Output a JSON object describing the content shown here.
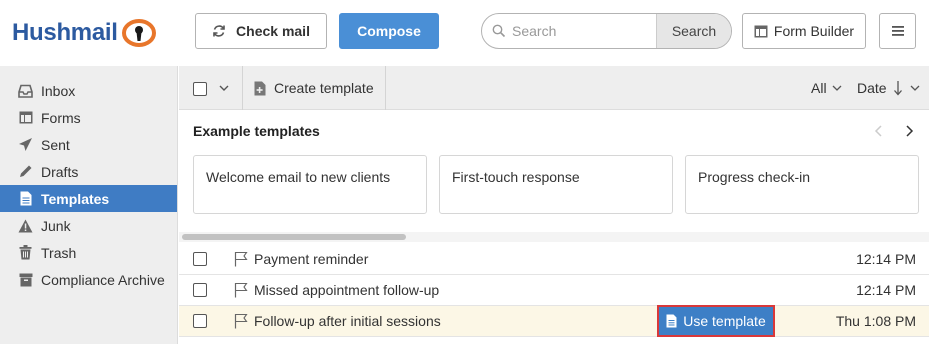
{
  "header": {
    "logo_text": "Hushmail",
    "check_mail_label": "Check mail",
    "compose_label": "Compose",
    "search_placeholder": "Search",
    "search_button_label": "Search",
    "form_builder_label": "Form Builder"
  },
  "sidebar": {
    "items": [
      {
        "label": "Inbox",
        "icon": "inbox-icon"
      },
      {
        "label": "Forms",
        "icon": "forms-icon"
      },
      {
        "label": "Sent",
        "icon": "sent-icon"
      },
      {
        "label": "Drafts",
        "icon": "drafts-icon"
      },
      {
        "label": "Templates",
        "icon": "templates-icon",
        "active": true
      },
      {
        "label": "Junk",
        "icon": "junk-icon"
      },
      {
        "label": "Trash",
        "icon": "trash-icon"
      },
      {
        "label": "Compliance Archive",
        "icon": "archive-icon"
      }
    ]
  },
  "toolbar": {
    "create_label": "Create template",
    "filter_label": "All",
    "sort_label": "Date"
  },
  "examples": {
    "title": "Example templates",
    "cards": [
      "Welcome email to new clients",
      "First-touch response",
      "Progress check-in"
    ]
  },
  "templates": [
    {
      "subject": "Payment reminder",
      "time": "12:14 PM"
    },
    {
      "subject": "Missed appointment follow-up",
      "time": "12:14 PM"
    },
    {
      "subject": "Follow-up after initial sessions",
      "time": "Thu 1:08 PM",
      "highlighted": true
    }
  ],
  "use_template_label": "Use template",
  "colors": {
    "brand_blue": "#2c5aa0",
    "accent_orange": "#e8762b",
    "active_nav": "#3f7cc4",
    "compose_button": "#4a8fd6",
    "highlight_row": "#fcf7e6",
    "focus_outline": "#d9383a"
  }
}
